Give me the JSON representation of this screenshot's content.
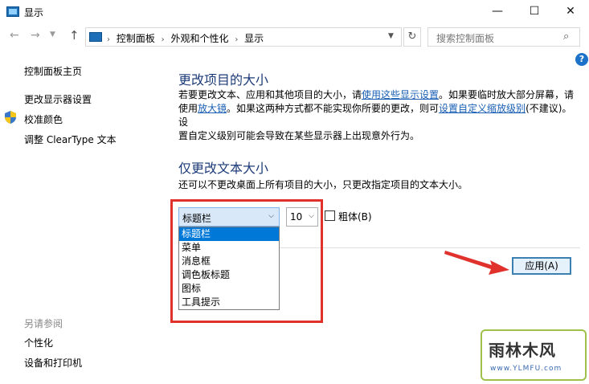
{
  "window": {
    "title": "显示",
    "controls": {
      "minimize": "—",
      "maximize": "☐",
      "close": "✕"
    }
  },
  "nav": {
    "back": "←",
    "forward": "→",
    "recent": "⌄",
    "up": "↑",
    "breadcrumb": [
      "控制面板",
      "外观和个性化",
      "显示"
    ],
    "search_placeholder": "搜索控制面板"
  },
  "sidebar": {
    "items": [
      {
        "label": "控制面板主页"
      },
      {
        "label": "更改显示器设置"
      },
      {
        "label": "校准颜色"
      },
      {
        "label": "调整 ClearType 文本"
      }
    ],
    "see_also_heading": "另请参阅",
    "see_also": [
      {
        "label": "个性化"
      },
      {
        "label": "设备和打印机"
      }
    ]
  },
  "main": {
    "section1_title": "更改项目的大小",
    "section1_p1_a": "若要更改文本、应用和其他项目的大小，请",
    "section1_link1": "使用这些显示设置",
    "section1_p1_b": "。如果要临时放大部分屏幕，请",
    "section1_p2_a": "使用",
    "section1_link2": "放大镜",
    "section1_p2_b": "。如果这两种方式都不能实现你所要的更改，则可",
    "section1_link3": "设置自定义缩放级别",
    "section1_p2_c": "(不建议)。设",
    "section1_p3": "置自定义级别可能会导致在某些显示器上出现意外行为。",
    "section2_title": "仅更改文本大小",
    "section2_desc": "还可以不更改桌面上所有项目的大小，只更改指定项目的文本大小。",
    "item_select_value": "标题栏",
    "size_select_value": "10",
    "bold_label": "粗体(B)",
    "dropdown_options": [
      "标题栏",
      "菜单",
      "消息框",
      "调色板标题",
      "图标",
      "工具提示"
    ],
    "apply_label": "应用(A)"
  },
  "help": "?",
  "watermark": {
    "title": "雨林木风",
    "url": "www.YLMFU.com"
  },
  "colors": {
    "annotation_red": "#e0312c",
    "link_blue": "#1a5fb4",
    "heading_blue": "#1c3b78",
    "selection_blue": "#0078d7"
  }
}
